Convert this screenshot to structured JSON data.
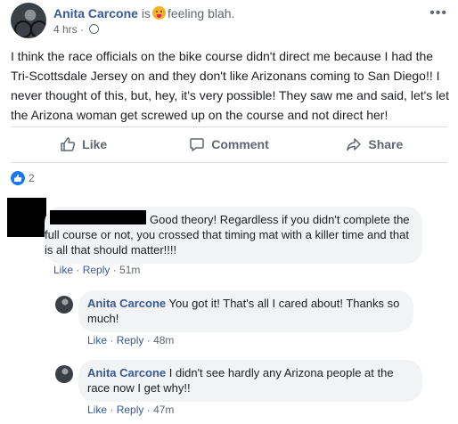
{
  "post": {
    "author": "Anita Carcone",
    "is_word": "is",
    "feeling_text": "feeling blah.",
    "time": "4 hrs",
    "time_sep": "·",
    "more_glyph": "•••",
    "text": "I think the race officials on the bike course didn't direct me because I had the Tri-Scottsdale Jersey on and they don't like Arizonans coming to San Diego!! I never thought of this, but, hey, it's very possible! They saw me and said, let's let the Arizona woman get screwed up on the course and not direct her!"
  },
  "actions": {
    "like": "Like",
    "comment": "Comment",
    "share": "Share"
  },
  "reactions": {
    "count": "2"
  },
  "comments": [
    {
      "text": "Good theory! Regardless if you didn't complete the full course or not, you crossed that timing mat with a killer time and that is all that should matter!!!!",
      "like": "Like",
      "reply": "Reply",
      "time": "51m"
    }
  ],
  "replies": [
    {
      "author": "Anita Carcone",
      "text": "You got it! That's all I cared about! Thanks so much!",
      "like": "Like",
      "reply": "Reply",
      "time": "48m"
    },
    {
      "author": "Anita Carcone",
      "text": "I didn't see hardly any Arizona people at the race now I get why!!",
      "like": "Like",
      "reply": "Reply",
      "time": "47m"
    }
  ],
  "colors": {
    "link": "#385898",
    "like_blue": "#1877f2",
    "bubble_bg": "#f2f3f5",
    "meta_gray": "#606770"
  }
}
